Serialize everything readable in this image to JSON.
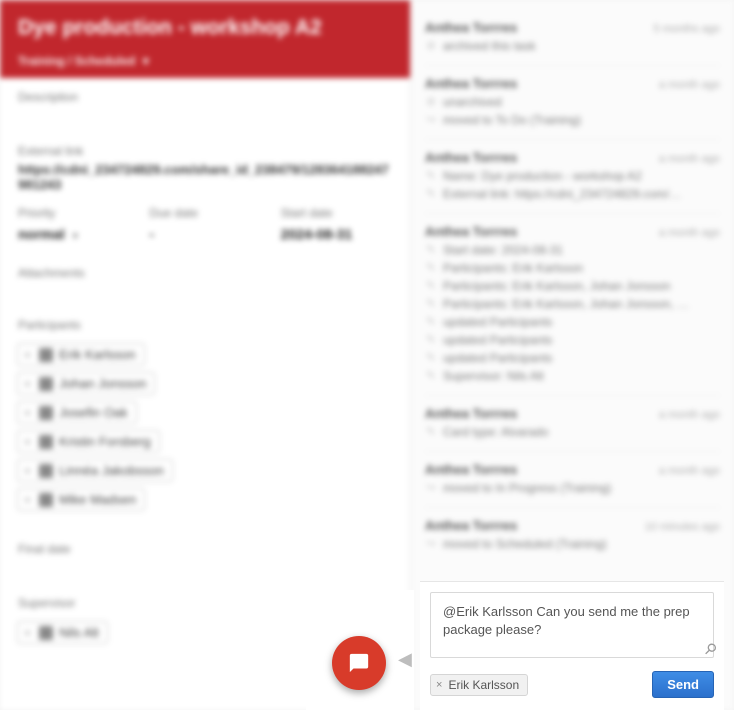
{
  "header": {
    "title": "Dye production - workshop A2",
    "breadcrumb": "Training / Scheduled",
    "breadcrumb_caret": "▾"
  },
  "fields": {
    "description_label": "Description",
    "external_link_label": "External link",
    "external_link_value": "https://cdni_234724829.com/share_id_238479/128364188247981243",
    "priority_label": "Priority",
    "priority_value": "normal",
    "due_date_label": "Due date",
    "due_date_value": "-",
    "start_date_label": "Start date",
    "start_date_value": "2024-08-31",
    "attachments_label": "Attachments",
    "participants_label": "Participants",
    "final_date_label": "Final date",
    "supervisor_label": "Supervisor",
    "supervisor_value": "Nils Alt"
  },
  "participants": [
    "Erik Karlsson",
    "Johan Jonsson",
    "Josefin Oak",
    "Kristin Forsberg",
    "Linnéa Jakobsson",
    "Mike Madsen"
  ],
  "supervisors": [
    "Nils Alt"
  ],
  "feed": [
    {
      "author": "Anthea Torrres",
      "time": "5 months ago",
      "lines": [
        {
          "icon": "archive",
          "text": "archived this task"
        }
      ]
    },
    {
      "author": "Anthea Torrres",
      "time": "a month ago",
      "lines": [
        {
          "icon": "unarchive",
          "text": "unarchived"
        },
        {
          "icon": "move",
          "text": "moved to To Do (Training)"
        }
      ]
    },
    {
      "author": "Anthea Torrres",
      "time": "a month ago",
      "lines": [
        {
          "icon": "edit",
          "text": "Name: Dye production - workshop A2"
        },
        {
          "icon": "edit",
          "text": "External link: https://cdni_234724829.com/…"
        }
      ]
    },
    {
      "author": "Anthea Torrres",
      "time": "a month ago",
      "lines": [
        {
          "icon": "edit",
          "text": "Start date: 2024-08-31"
        },
        {
          "icon": "edit",
          "text": "Participants: Erik Karlsson"
        },
        {
          "icon": "edit",
          "text": "Participants: Erik Karlsson, Johan Jonsson"
        },
        {
          "icon": "edit",
          "text": "Participants: Erik Karlsson, Johan Jonsson, …"
        },
        {
          "icon": "edit",
          "text": "updated Participants"
        },
        {
          "icon": "edit",
          "text": "updated Participants"
        },
        {
          "icon": "edit",
          "text": "updated Participants"
        },
        {
          "icon": "edit",
          "text": "Supervisor: Nils Alt"
        }
      ]
    },
    {
      "author": "Anthea Torrres",
      "time": "a month ago",
      "lines": [
        {
          "icon": "edit",
          "text": "Card type: Alvarado"
        }
      ]
    },
    {
      "author": "Anthea Torrres",
      "time": "a month ago",
      "lines": [
        {
          "icon": "move",
          "text": "moved to In Progress (Training)"
        }
      ]
    },
    {
      "author": "Anthea Torrres",
      "time": "10 minutes ago",
      "lines": [
        {
          "icon": "move",
          "text": "moved to Scheduled (Training)"
        }
      ]
    }
  ],
  "composer": {
    "text": "@Erik Karlsson Can you send me the prep package please?",
    "mention": "Erik Karlsson",
    "send_label": "Send"
  },
  "icons": {
    "edit_glyph": "✎",
    "move_glyph": "↪",
    "archive_glyph": "⊘",
    "remove_glyph": "×",
    "attach_glyph": "⚲",
    "back_glyph": "◀"
  }
}
